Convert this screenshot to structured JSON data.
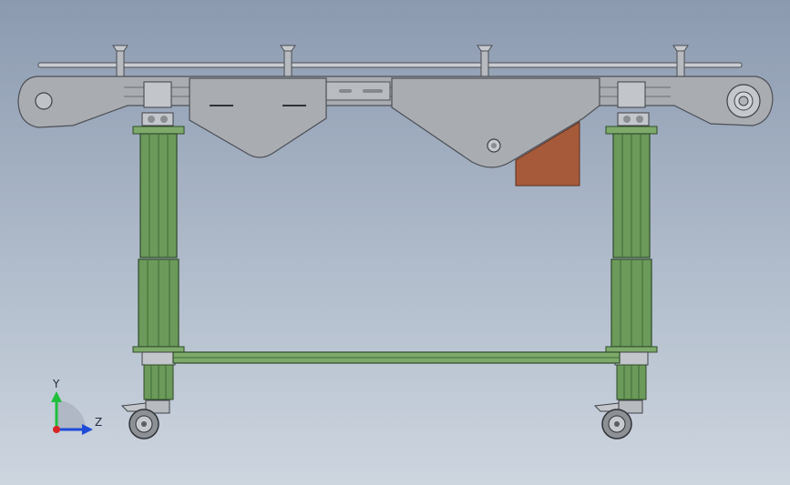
{
  "triad": {
    "y_label": "Y",
    "z_label": "Z"
  },
  "colors": {
    "background_top": "#8c9ab0",
    "background_bottom": "#cdd5df",
    "frame_gray": "#a9acb1",
    "frame_dark": "#5d6066",
    "leg_green": "#6b9a5a",
    "leg_green_dark": "#3f6a36",
    "bracket_brown": "#a65a3a",
    "axis_y": "#1fbf3c",
    "axis_z": "#1f4bd8",
    "axis_x": "#d82424"
  }
}
